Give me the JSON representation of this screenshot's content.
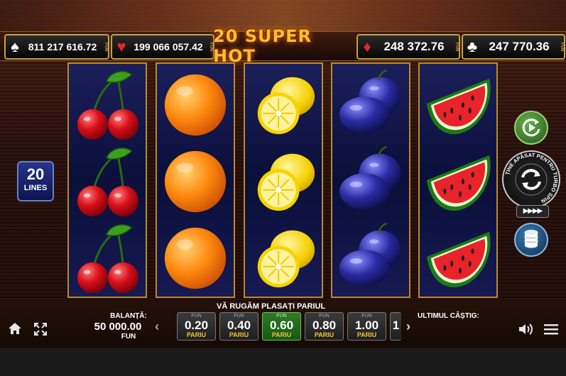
{
  "jackpots": [
    {
      "suit": "spade-icon",
      "glyph": "♠",
      "value": "811 217 616.72",
      "fun": "FUN",
      "color": "#ffffff"
    },
    {
      "suit": "heart-icon",
      "glyph": "♥",
      "value": "199 066 057.42",
      "fun": "FUN",
      "color": "#e0252a"
    },
    {
      "suit": "diamond-icon",
      "glyph": "♦",
      "value": "248 372.76",
      "fun": "FUN",
      "color": "#e0252a"
    },
    {
      "suit": "club-icon",
      "glyph": "♣",
      "value": "247 770.36",
      "fun": "FUN",
      "color": "#ffffff"
    }
  ],
  "logo": "20 SUPER HOT",
  "reels": [
    [
      "cherry",
      "cherry",
      "cherry"
    ],
    [
      "orange",
      "orange",
      "orange"
    ],
    [
      "lemon",
      "lemon",
      "lemon"
    ],
    [
      "plum",
      "plum",
      "plum"
    ],
    [
      "watermelon",
      "watermelon",
      "watermelon"
    ]
  ],
  "lines": {
    "number": "20",
    "label": "LINES"
  },
  "controls": {
    "autoplay_icon": "autoplay-icon",
    "spin_icon": "spin-arrows-icon",
    "spin_ring_text": "ȚINE APĂSAT PENTRU TURBO SPIN",
    "speed_icon": "speed-arrows-icon",
    "coins_icon": "coins-icon"
  },
  "bottom": {
    "prompt": "VĂ RUGĂM PLASAȚI PARIUL",
    "balance_label": "BALANȚĂ:",
    "balance_value": "50 000.00",
    "balance_unit": "FUN",
    "last_win_label": "ULTIMUL CÂȘTIG:",
    "bets": [
      {
        "fun": "FUN",
        "value": "0.20",
        "label": "PARIU",
        "selected": false
      },
      {
        "fun": "FUN",
        "value": "0.40",
        "label": "PARIU",
        "selected": false
      },
      {
        "fun": "FUN",
        "value": "0.60",
        "label": "PARIU",
        "selected": true
      },
      {
        "fun": "FUN",
        "value": "0.80",
        "label": "PARIU",
        "selected": false
      },
      {
        "fun": "FUN",
        "value": "1.00",
        "label": "PARIU",
        "selected": false
      }
    ],
    "bet_partial": "1",
    "prev_arrow": "‹",
    "next_arrow": "›",
    "icons": [
      "home-icon",
      "fullscreen-icon",
      "sound-icon",
      "menu-icon"
    ]
  }
}
